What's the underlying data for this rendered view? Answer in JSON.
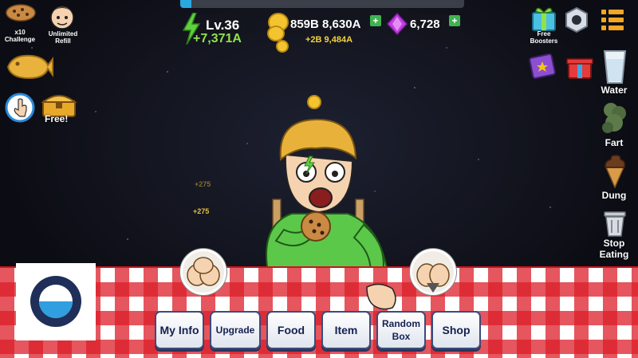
{
  "hud": {
    "level": "Lv.36",
    "level_bonus": "+7,371A",
    "coins": "859B 8,630A",
    "coins_rate": "+2B 9,484A",
    "gems": "6,728",
    "xp_progress_percent": 4,
    "plus_symbol": "+"
  },
  "left_panel": {
    "challenge_label": "x10\nChallenge",
    "refill_label": "Unlimited\nRefill",
    "free_label": "Free!"
  },
  "right_panel": {
    "boosters_label": "Free\nBoosters",
    "water_label": "Water",
    "fart_label": "Fart",
    "dung_label": "Dung",
    "stop_label": "Stop\nEating"
  },
  "floating": {
    "num1": "+275",
    "num2": "+275"
  },
  "menu": {
    "my_info": "My Info",
    "upgrade": "Upgrade",
    "food": "Food",
    "item": "Item",
    "random_box": "Random\nBox",
    "shop": "Shop"
  },
  "colors": {
    "xp": "#2aa8e0",
    "lv_bonus": "#8fe34a",
    "coin_rate": "#f5d23b",
    "plus": "#3fb34f",
    "cloth_red": "#dc1e28",
    "menu_text": "#142150"
  }
}
